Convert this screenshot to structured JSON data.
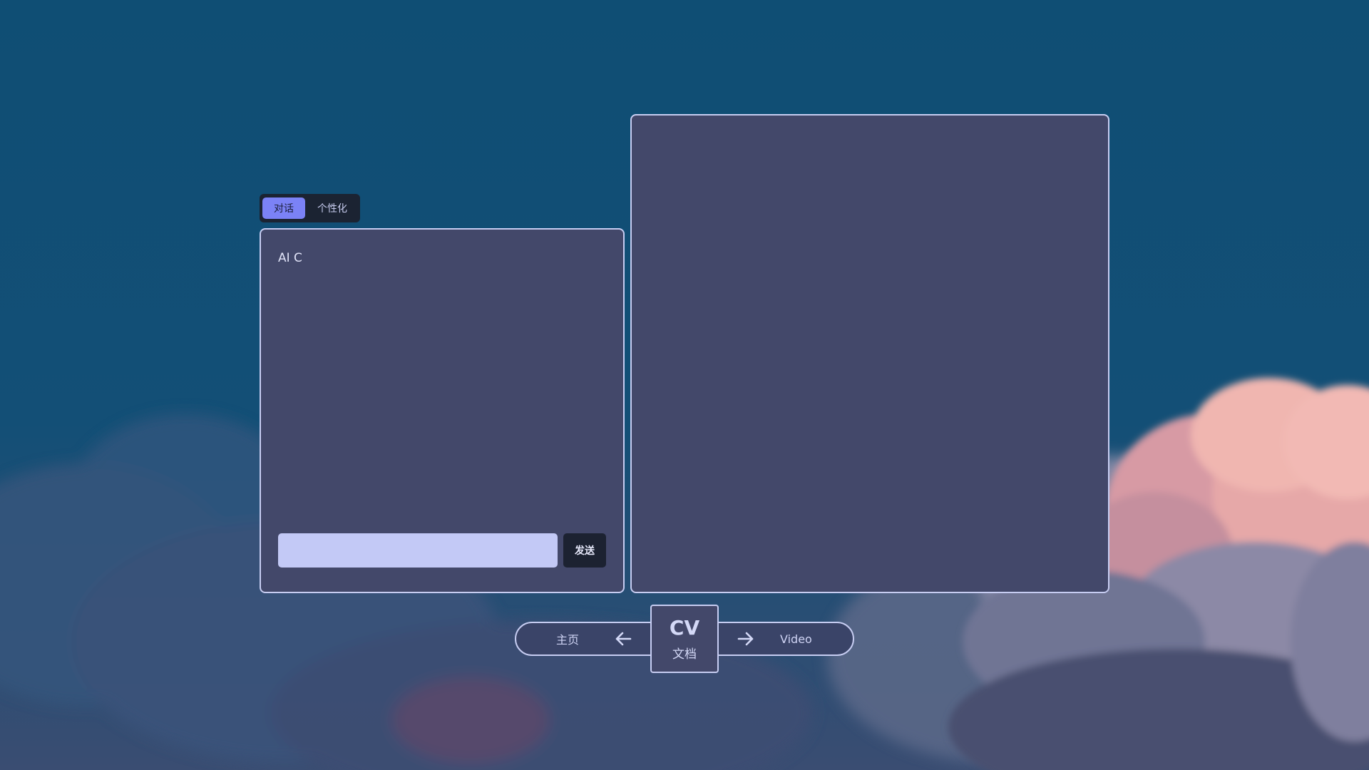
{
  "tabs": {
    "active_label": "对话",
    "inactive_label": "个性化"
  },
  "chat": {
    "message": "AI C",
    "input_value": "",
    "input_placeholder": "",
    "send_label": "发送"
  },
  "nav": {
    "home_label": "主页",
    "center_title": "CV",
    "center_subtitle": "文档",
    "video_label": "Video"
  },
  "colors": {
    "sky": "#0f4e74",
    "panel": "#43486a",
    "border": "#c7cdf2",
    "tab_active": "#7b82f6",
    "input": "#c3c9f6",
    "dark_button": "#1c2231",
    "cloud_pink": "#e39aa0"
  },
  "icons": {
    "left": "arrow-left-icon",
    "right": "arrow-right-icon"
  }
}
